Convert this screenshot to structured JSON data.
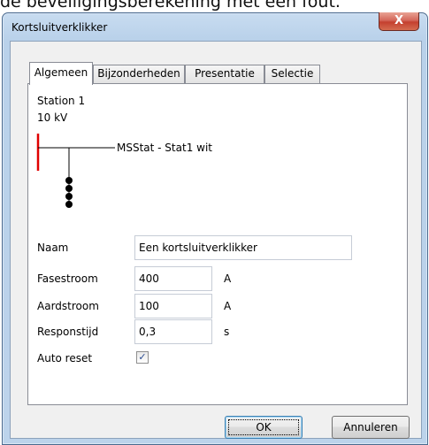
{
  "background_text": "de beveiligingsberekening met een fout.",
  "dialog": {
    "title": "Kortsluitverklikker",
    "close_glyph": "X",
    "tabs": [
      {
        "label": "Algemeen",
        "active": true
      },
      {
        "label": "Bijzonderheden",
        "active": false
      },
      {
        "label": "Presentatie",
        "active": false
      },
      {
        "label": "Selectie",
        "active": false
      }
    ]
  },
  "schematic": {
    "station_name": "Station 1",
    "voltage": "10 kV",
    "cable_label": "MSStat - Stat1 wit",
    "busbar_color": "#e00000"
  },
  "form": {
    "naam_label": "Naam",
    "naam_value": "Een kortsluitverklikker",
    "fasestroom_label": "Fasestroom",
    "fasestroom_value": "400",
    "fasestroom_unit": "A",
    "aardstroom_label": "Aardstroom",
    "aardstroom_value": "100",
    "aardstroom_unit": "A",
    "responstijd_label": "Responstijd",
    "responstijd_value": "0,3",
    "responstijd_unit": "s",
    "autoreset_label": "Auto reset",
    "autoreset_checked": true,
    "check_glyph": "✓"
  },
  "buttons": {
    "ok": "OK",
    "cancel": "Annuleren"
  }
}
